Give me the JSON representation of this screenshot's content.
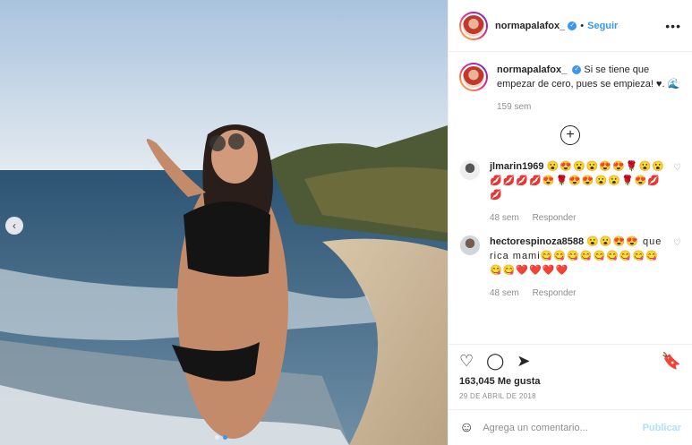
{
  "header": {
    "username": "normapalafox_",
    "verified_glyph": "✓",
    "separator": "•",
    "follow_label": "Seguir",
    "more_icon": "more-horizontal-icon"
  },
  "caption": {
    "username": "normapalafox_",
    "text": "Si se tiene que empezar de cero, pues se empieza! ♥. 🌊",
    "time": "159 sem"
  },
  "load_more": {
    "icon": "plus-circle-icon",
    "glyph": "+"
  },
  "comments": [
    {
      "username": "jlmarin1969",
      "text": "😮😍😮😮😍😍🌹😮😮💋💋💋💋😍🌹😍😍😮😮🌹😍💋💋",
      "time": "48 sem",
      "reply": "Responder"
    },
    {
      "username": "hectorespinoza8588",
      "text": "😮😮😍😍 que rica mami😋😋😋😋😋😋😋😋😋😋😋❤️❤️❤️❤️",
      "time": "48 sem",
      "reply": "Responder"
    }
  ],
  "actions": {
    "like_icon": "heart-icon",
    "comment_icon": "comment-icon",
    "share_icon": "share-icon",
    "save_icon": "bookmark-icon"
  },
  "likes": "163,045 Me gusta",
  "date": "29 DE ABRIL DE 2018",
  "add_comment": {
    "placeholder": "Agrega un comentario...",
    "publish_label": "Publicar"
  },
  "colors": {
    "accent": "#3897f0",
    "publish_disabled": "#b2dffc"
  }
}
